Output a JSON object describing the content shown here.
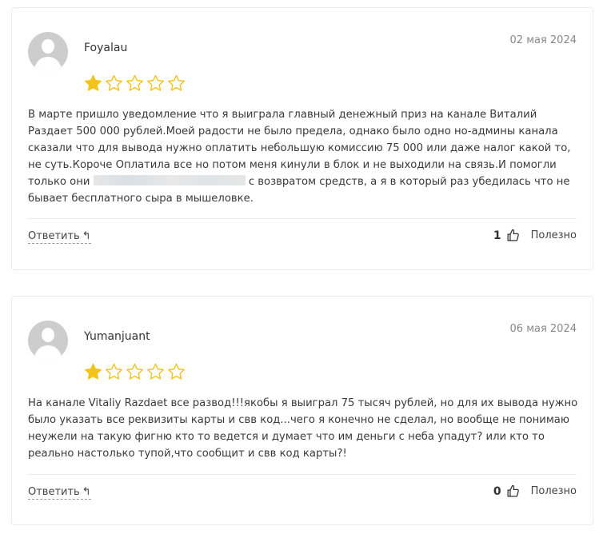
{
  "reviews": [
    {
      "author": "Foyalau",
      "date": "02 мая 2024",
      "rating": 1,
      "rating_max": 5,
      "text_before_redaction": "В марте пришло уведомление что я выиграла главный денежный приз на канале Виталий Раздает 500 000 рублей.Моей радости не было предела, однако было одно но-админы канала сказали что для вывода нужно оплатить небольшую комиссию 75 000 или даже налог какой то, не суть.Короче Оплатила все но потом меня кинули в блок и не выходили на связь.И помогли только они ",
      "text_after_redaction": " с возвратом средств, а я в который раз убедилась что не бывает бесплатного сыра в мышеловке.",
      "reply_label": "Ответить",
      "likes": "1",
      "useful_label": "Полезно"
    },
    {
      "author": "Yumanjuant",
      "date": "06 мая 2024",
      "rating": 1,
      "rating_max": 5,
      "text": "На канале Vitaliy Razdaet все развод!!!якобы я выиграл 75 тысяч рублей, но для их вывода нужно было указать все реквизиты карты и свв код...чего я конечно не сделал, но вообще не понимаю неужели на такую фигню кто то ведется и думает что им деньги с неба упадут? или кто то реально настолько тупой,что сообщит и свв код карты?!",
      "reply_label": "Ответить",
      "likes": "0",
      "useful_label": "Полезно"
    }
  ],
  "icons": {
    "star_filled_color": "#f2c31b",
    "star_empty_color": "#f2c31b",
    "reply_icon": "reply-arrow-icon",
    "thumb_icon": "thumbs-up-icon"
  }
}
